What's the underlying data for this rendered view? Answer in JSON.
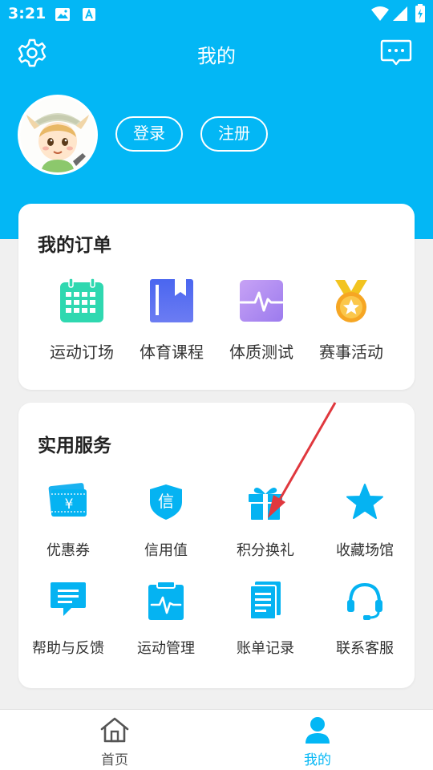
{
  "status_bar": {
    "time": "3:21"
  },
  "header": {
    "title": "我的",
    "login_label": "登录",
    "register_label": "注册"
  },
  "orders": {
    "title": "我的订单",
    "items": [
      {
        "label": "运动订场",
        "icon": "calendar-icon"
      },
      {
        "label": "体育课程",
        "icon": "book-icon"
      },
      {
        "label": "体质测试",
        "icon": "pulse-monitor-icon"
      },
      {
        "label": "赛事活动",
        "icon": "medal-icon"
      }
    ]
  },
  "services": {
    "title": "实用服务",
    "items": [
      {
        "label": "优惠券",
        "icon": "coupon-icon"
      },
      {
        "label": "信用值",
        "icon": "credit-shield-icon"
      },
      {
        "label": "积分换礼",
        "icon": "gift-icon"
      },
      {
        "label": "收藏场馆",
        "icon": "star-icon"
      },
      {
        "label": "帮助与反馈",
        "icon": "chat-bubble-icon"
      },
      {
        "label": "运动管理",
        "icon": "clipboard-pulse-icon"
      },
      {
        "label": "账单记录",
        "icon": "document-icon"
      },
      {
        "label": "联系客服",
        "icon": "headset-icon"
      }
    ],
    "coupon_symbol": "¥",
    "credit_symbol": "信"
  },
  "bottom_nav": {
    "items": [
      {
        "label": "首页",
        "icon": "home-icon",
        "active": false
      },
      {
        "label": "我的",
        "icon": "user-icon",
        "active": true
      }
    ]
  },
  "colors": {
    "primary": "#03b7f5",
    "calendar": "#2fd8b0",
    "book": "#5a6ff0",
    "pulse": "#b48ef2",
    "medal": "#f6a623",
    "annotation_arrow": "#e0383e"
  }
}
